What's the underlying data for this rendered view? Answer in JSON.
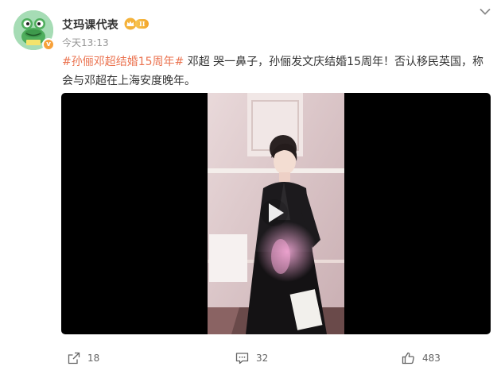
{
  "user": {
    "name": "艾玛课代表",
    "vip_level": "II",
    "verified_mark": "v",
    "avatar_icon": "frog-avatar-icon"
  },
  "post": {
    "time": "今天13:13",
    "hashtag": "#孙俪邓超结婚15周年#",
    "text": " 邓超 哭一鼻子，孙俪发文庆结婚15周年！否认移民英国，称会与邓超在上海安度晚年。"
  },
  "video": {
    "play_icon": "play-icon"
  },
  "actions": {
    "share_count": "18",
    "comment_count": "32",
    "like_count": "483"
  },
  "colors": {
    "hashtag": "#eb7350",
    "meta": "#939393",
    "accent_badge": "#f7a13a"
  }
}
